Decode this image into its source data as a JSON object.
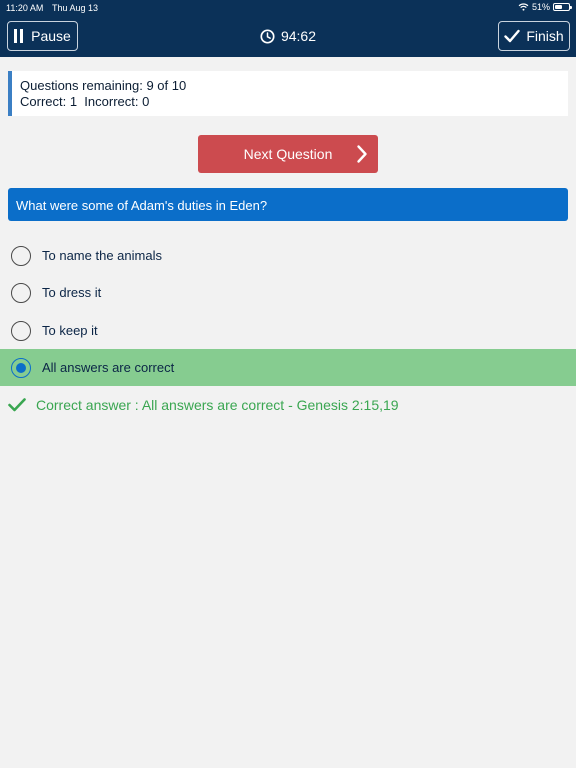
{
  "status_bar": {
    "time": "11:20 AM",
    "date": "Thu Aug 13",
    "battery": "51%",
    "battery_level": 0.51
  },
  "header": {
    "pause_label": "Pause",
    "timer": "94:62",
    "finish_label": "Finish"
  },
  "score": {
    "remaining": "Questions remaining: 9 of 10",
    "tally": "Correct: 1  Incorrect: 0"
  },
  "next_button": {
    "label": "Next Question"
  },
  "question": {
    "text": "What were some of Adam's duties in Eden?"
  },
  "answers": [
    {
      "label": "To name the animals",
      "selected": false
    },
    {
      "label": "To dress it",
      "selected": false
    },
    {
      "label": "To keep it",
      "selected": false
    },
    {
      "label": "All answers are correct",
      "selected": true
    }
  ],
  "feedback": {
    "text": "Correct answer : All answers are correct - Genesis 2:15,19"
  },
  "colors": {
    "header_bg": "#0b3158",
    "question_bg": "#0b6ec9",
    "next_bg": "#cc4b4f",
    "selected_bg": "#86cc90",
    "correct_text": "#3aa651"
  }
}
